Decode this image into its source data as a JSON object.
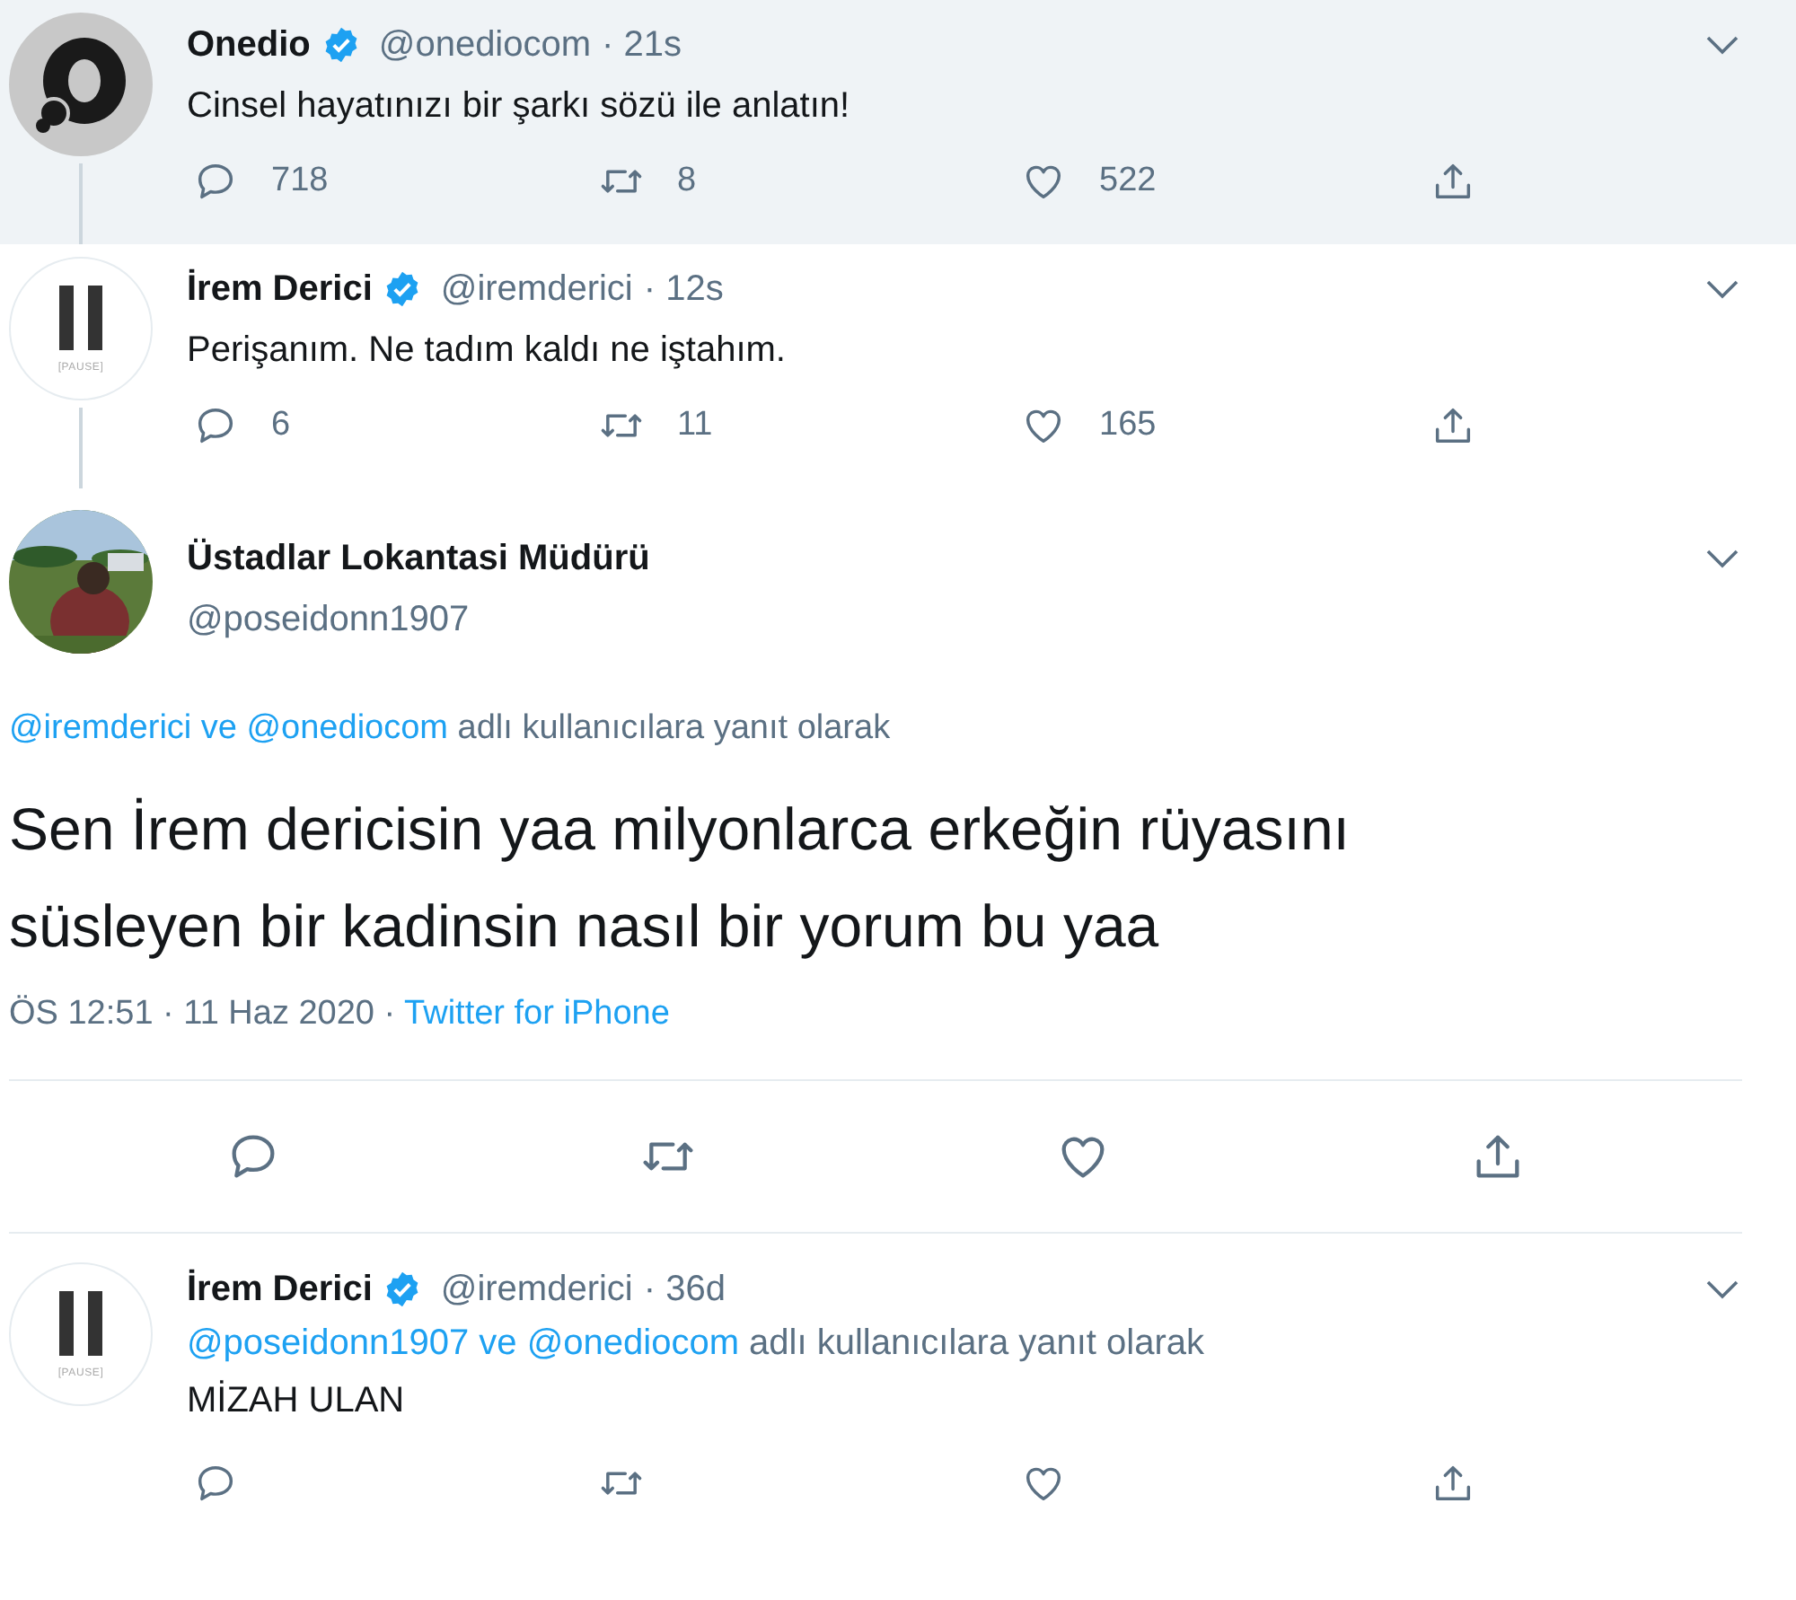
{
  "thread": [
    {
      "name": "Onedio",
      "verified": true,
      "handle": "@onediocom",
      "time": "· 21s",
      "highlighted": true,
      "thread_below": true,
      "avatar": {
        "kind": "ring-logo"
      },
      "text": "Cinsel hayatınızı bir şarkı sözü ile anlatın!",
      "actions": [
        {
          "kind": "reply",
          "count": "718"
        },
        {
          "kind": "retweet",
          "count": "8"
        },
        {
          "kind": "like",
          "count": "522"
        },
        {
          "kind": "share"
        }
      ]
    },
    {
      "name": "İrem Derici",
      "verified": true,
      "handle": "@iremderici",
      "time": "· 12s",
      "highlighted": false,
      "thread_below": true,
      "avatar": {
        "kind": "pause-logo",
        "label": "[PAUSE]"
      },
      "text": "Perişanım. Ne tadım kaldı ne iştahım.",
      "actions": [
        {
          "kind": "reply",
          "count": "6"
        },
        {
          "kind": "retweet",
          "count": "11"
        },
        {
          "kind": "like",
          "count": "165"
        },
        {
          "kind": "share"
        }
      ]
    }
  ],
  "main_tweet": {
    "name": "Üstadlar Lokantasi Müdürü",
    "handle": "@poseidonn1907",
    "reply_to": {
      "mentions": "@iremderici ve @onediocom",
      "text": "adlı kullanıcılara yanıt olarak"
    },
    "text": "Sen İrem dericisin yaa milyonlarca erkeğin rüyasını süsleyen bir kadinsin nasıl bir yorum bu yaa",
    "date": "ÖS 12:51 · 11 Haz 2020 ·",
    "source": "Twitter for iPhone",
    "actions": [
      {
        "kind": "reply"
      },
      {
        "kind": "retweet"
      },
      {
        "kind": "like"
      },
      {
        "kind": "share"
      }
    ]
  },
  "replies": [
    {
      "name": "İrem Derici",
      "verified": true,
      "handle": "@iremderici",
      "time": "· 36d",
      "avatar": {
        "kind": "pause-logo",
        "label": "[PAUSE]"
      },
      "reply_to": {
        "mentions": "@poseidonn1907 ve @onediocom",
        "text": "adlı kullanıcılara yanıt olarak"
      },
      "text": "MİZAH ULAN",
      "actions": [
        {
          "kind": "reply"
        },
        {
          "kind": "retweet"
        },
        {
          "kind": "like"
        },
        {
          "kind": "share"
        }
      ]
    }
  ]
}
